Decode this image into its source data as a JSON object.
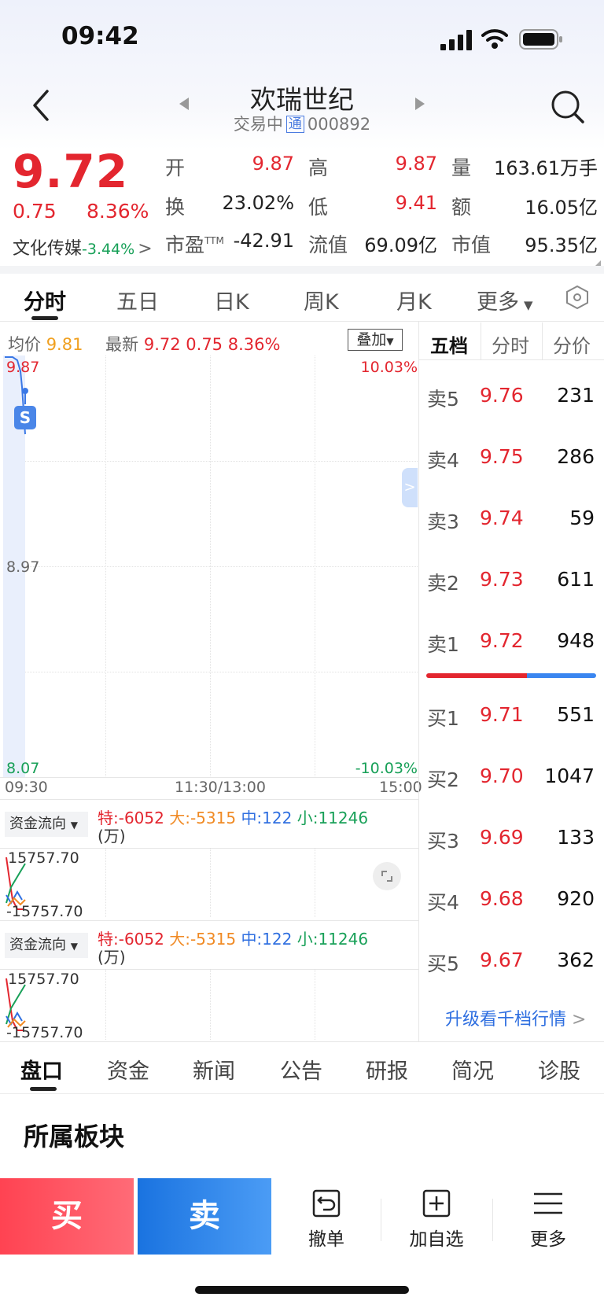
{
  "status_bar": {
    "time": "09:42"
  },
  "header": {
    "title": "欢瑞世纪",
    "status": "交易中",
    "badge": "通",
    "code": "000892"
  },
  "quote": {
    "price": "9.72",
    "change": "0.75",
    "change_pct": "8.36%",
    "sector_name": "文化传媒",
    "sector_pct": "-3.44%",
    "rows": [
      [
        {
          "label": "开",
          "value": "9.87"
        },
        {
          "label": "高",
          "value": "9.87"
        },
        {
          "label": "量",
          "value": "163.61万手"
        }
      ],
      [
        {
          "label": "换",
          "value": "23.02%"
        },
        {
          "label": "低",
          "value": "9.41"
        },
        {
          "label": "额",
          "value": "16.05亿"
        }
      ],
      [
        {
          "label": "市盈",
          "sup": "TTM",
          "value": "-42.91"
        },
        {
          "label": "流值",
          "value": "69.09亿"
        },
        {
          "label": "市值",
          "value": "95.35亿"
        }
      ]
    ]
  },
  "tabs": [
    "分时",
    "五日",
    "日K",
    "周K",
    "月K",
    "更多"
  ],
  "chart": {
    "avg_label": "均价",
    "avg_value": "9.81",
    "latest_label": "最新",
    "latest_price": "9.72",
    "latest_change": "0.75",
    "latest_pct": "8.36%",
    "overlay_button": "叠加",
    "y_top": "9.87",
    "y_mid": "8.97",
    "y_bottom": "8.07",
    "pct_top": "10.03%",
    "pct_bottom": "-10.03%",
    "time_start": "09:30",
    "time_mid": "11:30/13:00",
    "time_end": "15:00",
    "marker": "S"
  },
  "fund_flow": {
    "selector": "资金流向",
    "te": "特:-6052",
    "da": "大:-5315",
    "zhong": "中:122",
    "xiao": "小:11246",
    "unit": "(万)",
    "max": "15757.70",
    "min": "-15757.70"
  },
  "order_book": {
    "tabs": [
      "五档",
      "分时",
      "分价"
    ],
    "asks": [
      {
        "label": "卖5",
        "price": "9.76",
        "vol": "231"
      },
      {
        "label": "卖4",
        "price": "9.75",
        "vol": "286"
      },
      {
        "label": "卖3",
        "price": "9.74",
        "vol": "59"
      },
      {
        "label": "卖2",
        "price": "9.73",
        "vol": "611"
      },
      {
        "label": "卖1",
        "price": "9.72",
        "vol": "948"
      }
    ],
    "bids": [
      {
        "label": "买1",
        "price": "9.71",
        "vol": "551"
      },
      {
        "label": "买2",
        "price": "9.70",
        "vol": "1047"
      },
      {
        "label": "买3",
        "price": "9.69",
        "vol": "133"
      },
      {
        "label": "买4",
        "price": "9.68",
        "vol": "920"
      },
      {
        "label": "买5",
        "price": "9.67",
        "vol": "362"
      }
    ],
    "upgrade_link": "升级看千档行情"
  },
  "bottom_tabs": [
    "盘口",
    "资金",
    "新闻",
    "公告",
    "研报",
    "简况",
    "诊股"
  ],
  "section_title": "所属板块",
  "actions": {
    "buy": "买",
    "sell": "卖",
    "cancel": "撤单",
    "add_watch": "加自选",
    "more": "更多"
  },
  "colors": {
    "up": "#e3262f",
    "down": "#18a058",
    "accent": "#1a73e0"
  }
}
